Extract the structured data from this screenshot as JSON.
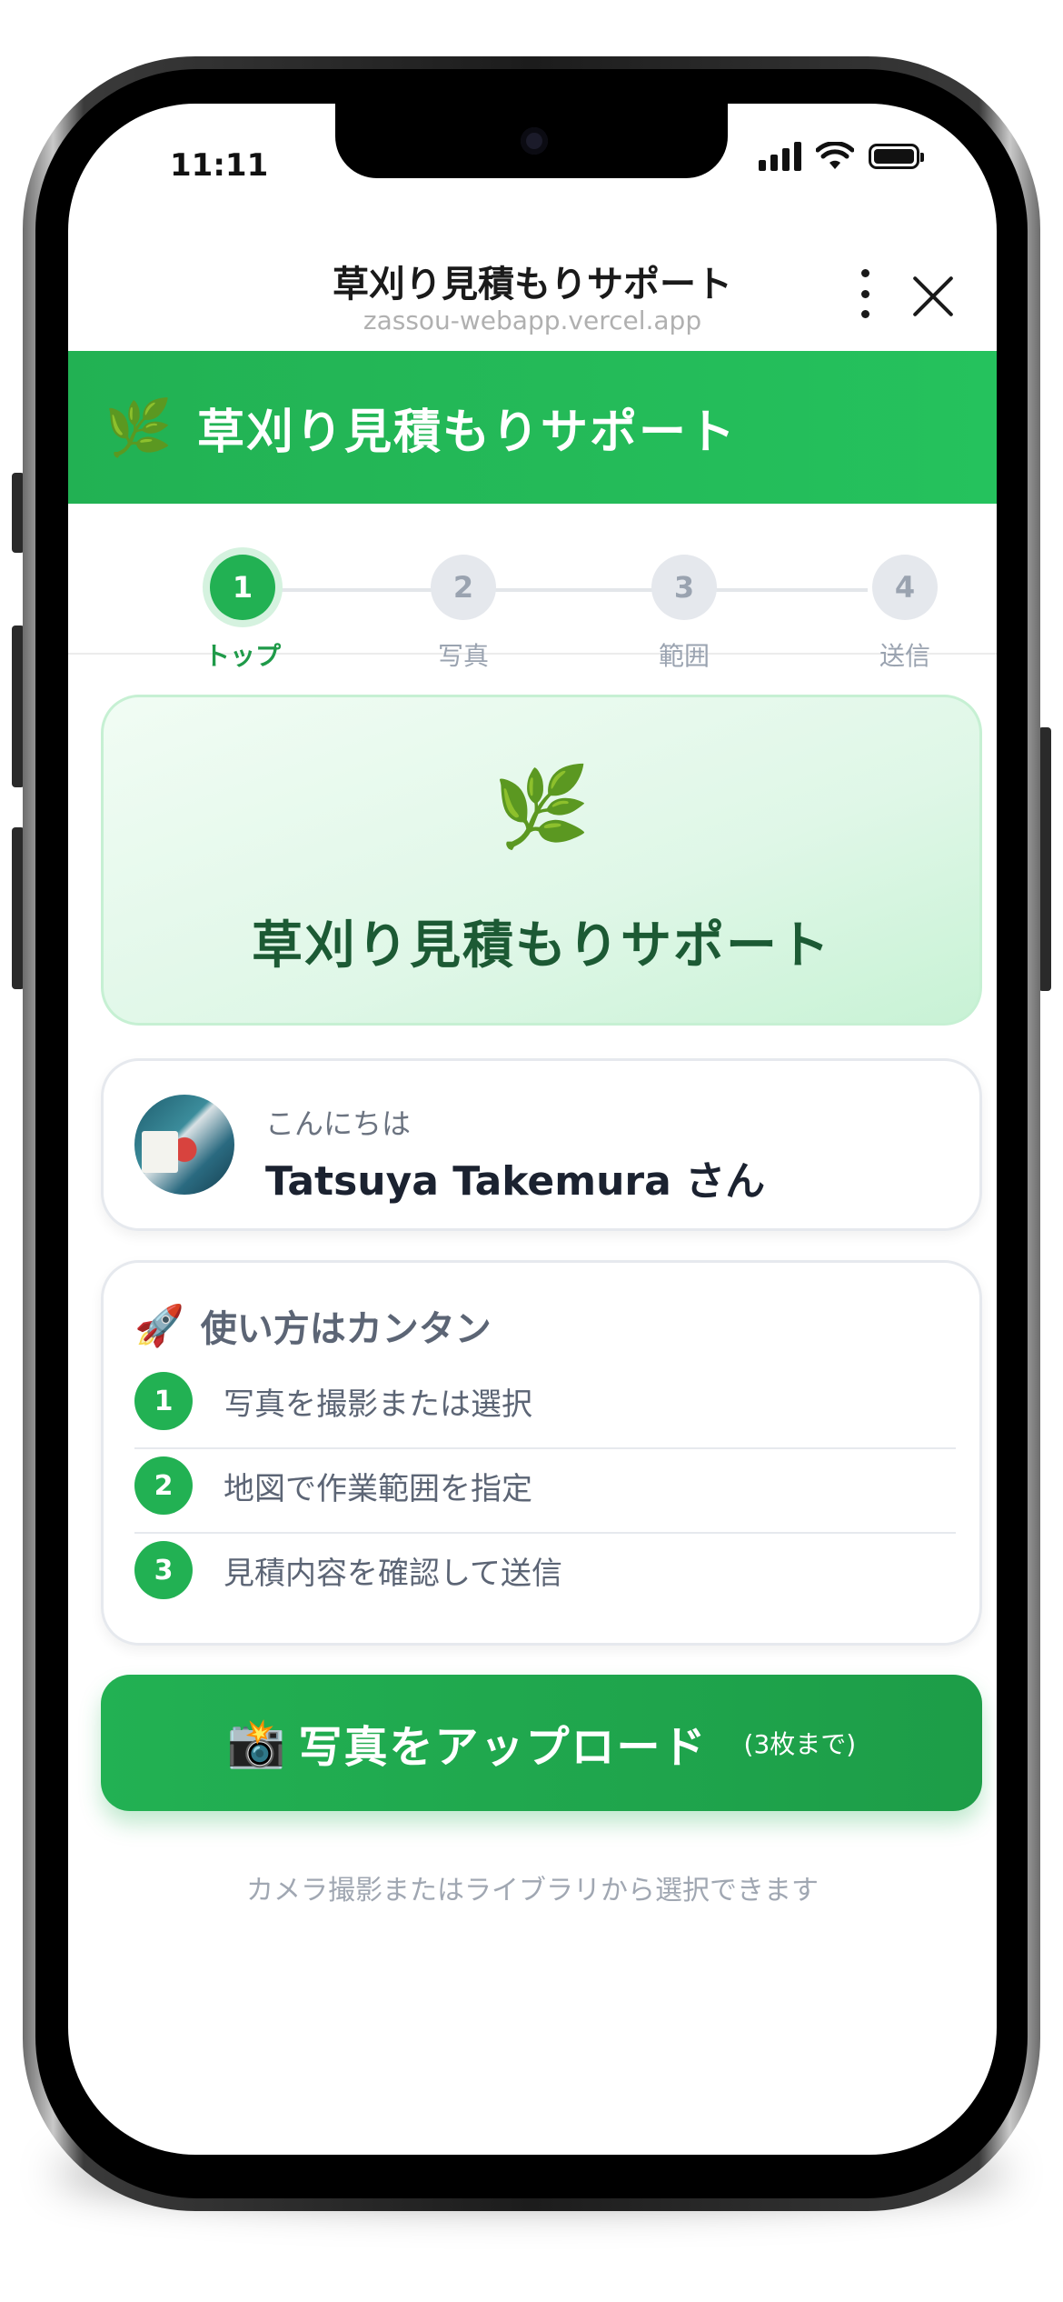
{
  "status_bar": {
    "time": "11:11"
  },
  "browser": {
    "title": "草刈り見積もりサポート",
    "url": "zassou-webapp.vercel.app",
    "menu_icon": "kebab-menu-icon",
    "close_icon": "close-icon"
  },
  "app_header": {
    "icon": "🌿",
    "title": "草刈り見積もりサポート"
  },
  "stepper": {
    "steps": [
      {
        "number": "1",
        "label": "トップ",
        "active": true
      },
      {
        "number": "2",
        "label": "写真",
        "active": false
      },
      {
        "number": "3",
        "label": "範囲",
        "active": false
      },
      {
        "number": "4",
        "label": "送信",
        "active": false
      }
    ]
  },
  "hero": {
    "icon": "🌿",
    "title": "草刈り見積もりサポート"
  },
  "user_card": {
    "greeting": "こんにちは",
    "name": "Tatsuya Takemura さん"
  },
  "howto": {
    "icon": "🚀",
    "title": "使い方はカンタン",
    "steps": [
      {
        "number": "1",
        "text": "写真を撮影または選択"
      },
      {
        "number": "2",
        "text": "地図で作業範囲を指定"
      },
      {
        "number": "3",
        "text": "見積内容を確認して送信"
      }
    ]
  },
  "upload_button": {
    "icon": "📸",
    "label": "写真をアップロード",
    "sub_label": "(3枚まで)"
  },
  "hint": "カメラ撮影またはライブラリから選択できます",
  "colors": {
    "brand_green": "#22b153",
    "hero_title": "#1c5a34"
  }
}
